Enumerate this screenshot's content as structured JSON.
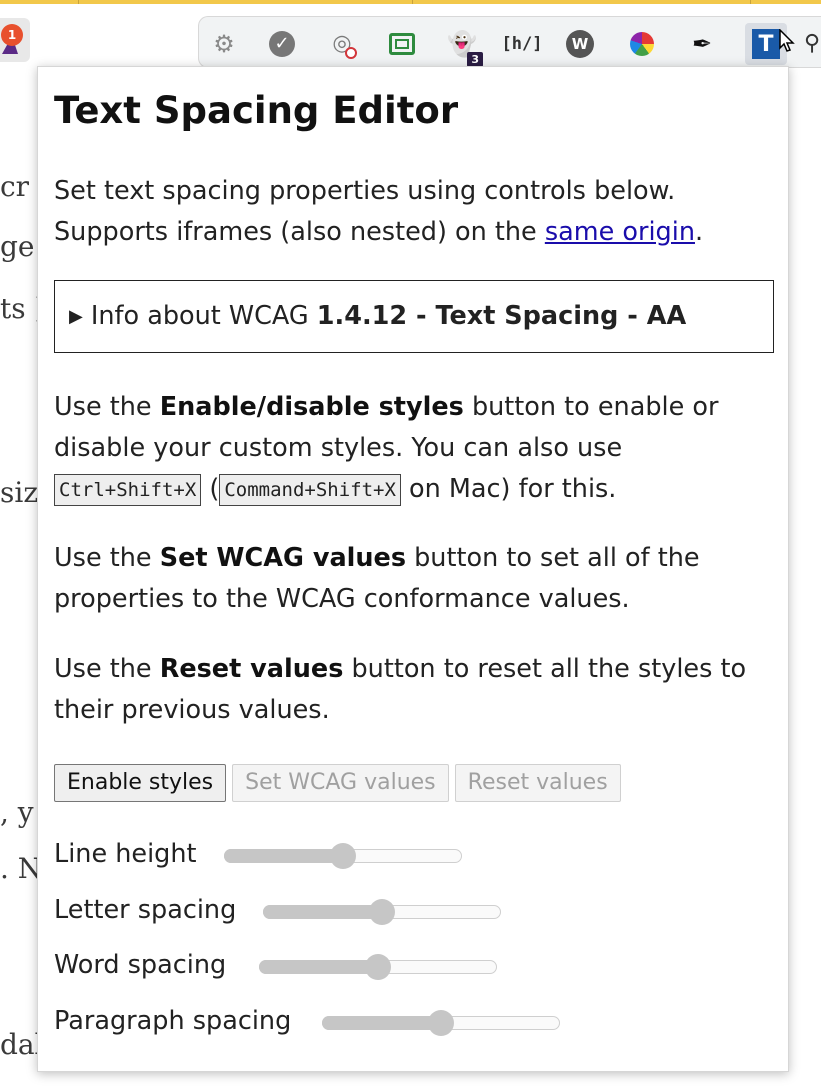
{
  "toolbar": {
    "left_badge": "1",
    "ghost_badge": "3",
    "h_label": "[h/]",
    "w_label": "W",
    "t_label": "T",
    "icons": [
      "gear-icon",
      "check-icon",
      "fingerprint-icon",
      "frame-icon",
      "ghost-icon",
      "hypothesis-icon",
      "wappalyzer-icon",
      "color-wheel-icon",
      "eyedropper-icon",
      "text-spacing-icon",
      "puzzle-icon"
    ]
  },
  "background_text": [
    "cr",
    "ge a",
    "ts ]",
    "siz",
    ", y",
    ". N",
    "dal"
  ],
  "popup": {
    "title": "Text Spacing Editor",
    "intro_line1": "Set text spacing properties using controls below.",
    "intro_line2_prefix": "Supports iframes (also nested) on the ",
    "intro_link": "same origin",
    "intro_line2_suffix": ".",
    "details_prefix": "Info about WCAG ",
    "details_bold": "1.4.12 - Text Spacing - AA",
    "para1_a": "Use the ",
    "para1_b": "Enable/disable styles",
    "para1_c": " button to enable or disable your custom styles. You can also use ",
    "kbd1": "Ctrl+Shift+X",
    "para1_d": " (",
    "kbd2": "Command+Shift+X",
    "para1_e": " on Mac) for this.",
    "para2_a": "Use the ",
    "para2_b": "Set WCAG values",
    "para2_c": " button to set all of the properties to the WCAG conformance values.",
    "para3_a": "Use the ",
    "para3_b": "Reset values",
    "para3_c": " button to reset all the styles to their previous values.",
    "buttons": {
      "enable": "Enable styles",
      "set_wcag": "Set WCAG values",
      "reset": "Reset values"
    },
    "sliders": [
      {
        "label": "Line height",
        "value": 0.5
      },
      {
        "label": "Letter spacing",
        "value": 0.5
      },
      {
        "label": "Word spacing",
        "value": 0.5
      },
      {
        "label": "Paragraph spacing",
        "value": 0.5
      }
    ]
  },
  "colors": {
    "link": "#1a0dab",
    "accent_top": "#f2c84b",
    "t_icon": "#1a5aa8"
  }
}
